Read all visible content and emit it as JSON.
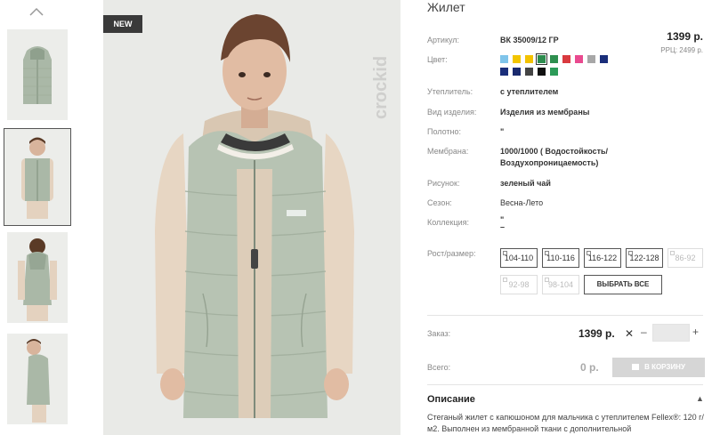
{
  "thumbnails": {
    "items": [
      {
        "alt": "vest-front"
      },
      {
        "alt": "boy-front"
      },
      {
        "alt": "boy-back"
      },
      {
        "alt": "boy-side"
      }
    ]
  },
  "main_photo": {
    "badge": "NEW",
    "brand_mark": "crockid"
  },
  "product": {
    "title": "Жилет",
    "price": "1399 р.",
    "rrp": "РРЦ: 2499 р.",
    "attributes": [
      {
        "label": "Артикул:",
        "value": "ВК 35009/12 ГР"
      },
      {
        "label": "Цвет:",
        "value": ""
      },
      {
        "label": "Утеплитель:",
        "value": "с утеплителем"
      },
      {
        "label": "Вид изделия:",
        "value": "Изделия из мембраны"
      },
      {
        "label": "Полотно:",
        "value": "\""
      },
      {
        "label": "Мембрана:",
        "value": "1000/1000 ( Водостойкость/"
      },
      {
        "label": "",
        "value": "Воздухопроницаемость)"
      },
      {
        "label": "Рисунок:",
        "value": "зеленый чай"
      },
      {
        "label": "Сезон:",
        "value": "Весна-Лето"
      },
      {
        "label": "Коллекция:",
        "value": "\""
      },
      {
        "label": "",
        "value": "–"
      }
    ],
    "color_swatches": [
      "#7fc4ea",
      "#f2c500",
      "#f3c200",
      "#2d8c4e",
      "#2e8f4f",
      "#d93a3f",
      "#e94a8f",
      "#a7a7a7",
      "#1a2e7a",
      "#1a2e7a",
      "#1a2a6e",
      "#444444",
      "#111111",
      "#2c9b58"
    ],
    "selected_swatch": 3
  },
  "sizes": {
    "label": "Рост/размер:",
    "items": [
      {
        "label": "104-110",
        "enabled": true
      },
      {
        "label": "110-116",
        "enabled": true
      },
      {
        "label": "116-122",
        "enabled": true
      },
      {
        "label": "122-128",
        "enabled": true
      },
      {
        "label": "86-92",
        "enabled": false
      },
      {
        "label": "92-98",
        "enabled": false
      },
      {
        "label": "98-104",
        "enabled": false
      }
    ],
    "select_all": "ВЫБРАТЬ ВСЕ"
  },
  "order": {
    "label": "Заказ:",
    "price": "1399 р.",
    "remove_symbol": "✕",
    "minus": "–",
    "quantity": "",
    "plus": "+"
  },
  "total": {
    "label": "Всего:",
    "value": "0 р.",
    "cart_button": "В КОРЗИНУ"
  },
  "description": {
    "title": "Описание",
    "chevron": "▲",
    "text": "Стеганый жилет с капюшоном для мальчика с утеплителем Fellex®: 120 г/м2. Выполнен из мембранной ткани с дополнительной"
  }
}
